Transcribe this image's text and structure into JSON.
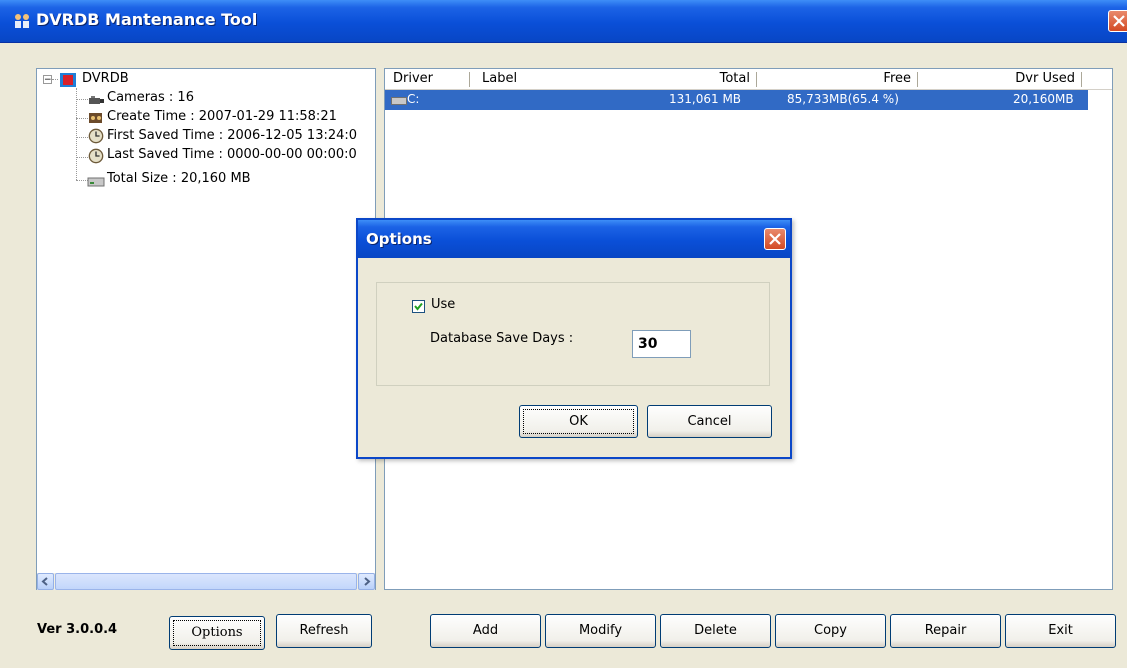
{
  "window": {
    "title": "DVRDB Mantenance Tool",
    "icon": "app-people-icon"
  },
  "tree": {
    "root": "DVRDB",
    "items": [
      {
        "icon": "camera-icon",
        "label": "Cameras : 16"
      },
      {
        "icon": "film-reel-icon",
        "label": "Create Time : 2007-01-29 11:58:21"
      },
      {
        "icon": "clock-icon",
        "label": "First Saved Time : 2006-12-05 13:24:0"
      },
      {
        "icon": "clock-icon",
        "label": "Last Saved Time : 0000-00-00 00:00:0"
      },
      {
        "icon": "drive-icon",
        "label": "Total Size : 20,160 MB"
      }
    ],
    "expander": "−"
  },
  "list": {
    "columns": [
      "Driver",
      "Label",
      "Total",
      "Free",
      "Dvr Used"
    ],
    "rows": [
      {
        "driver": "C:",
        "label": "",
        "total": "131,061 MB",
        "free": "85,733MB(65.4 %)",
        "dvr_used": "20,160MB"
      }
    ],
    "selection_color": "#316ac5"
  },
  "footer": {
    "version": "Ver 3.0.0.4",
    "buttons": {
      "options": "Options",
      "refresh": "Refresh",
      "add": "Add",
      "modify": "Modify",
      "delete": "Delete",
      "copy": "Copy",
      "repair": "Repair",
      "exit": "Exit"
    }
  },
  "dialog": {
    "title": "Options",
    "use_label": "Use",
    "use_checked": true,
    "save_days_label": "Database Save Days :",
    "save_days_value": "30",
    "ok": "OK",
    "cancel": "Cancel"
  },
  "colors": {
    "titlebar": "#0a4fd8",
    "face": "#ece9d8"
  }
}
